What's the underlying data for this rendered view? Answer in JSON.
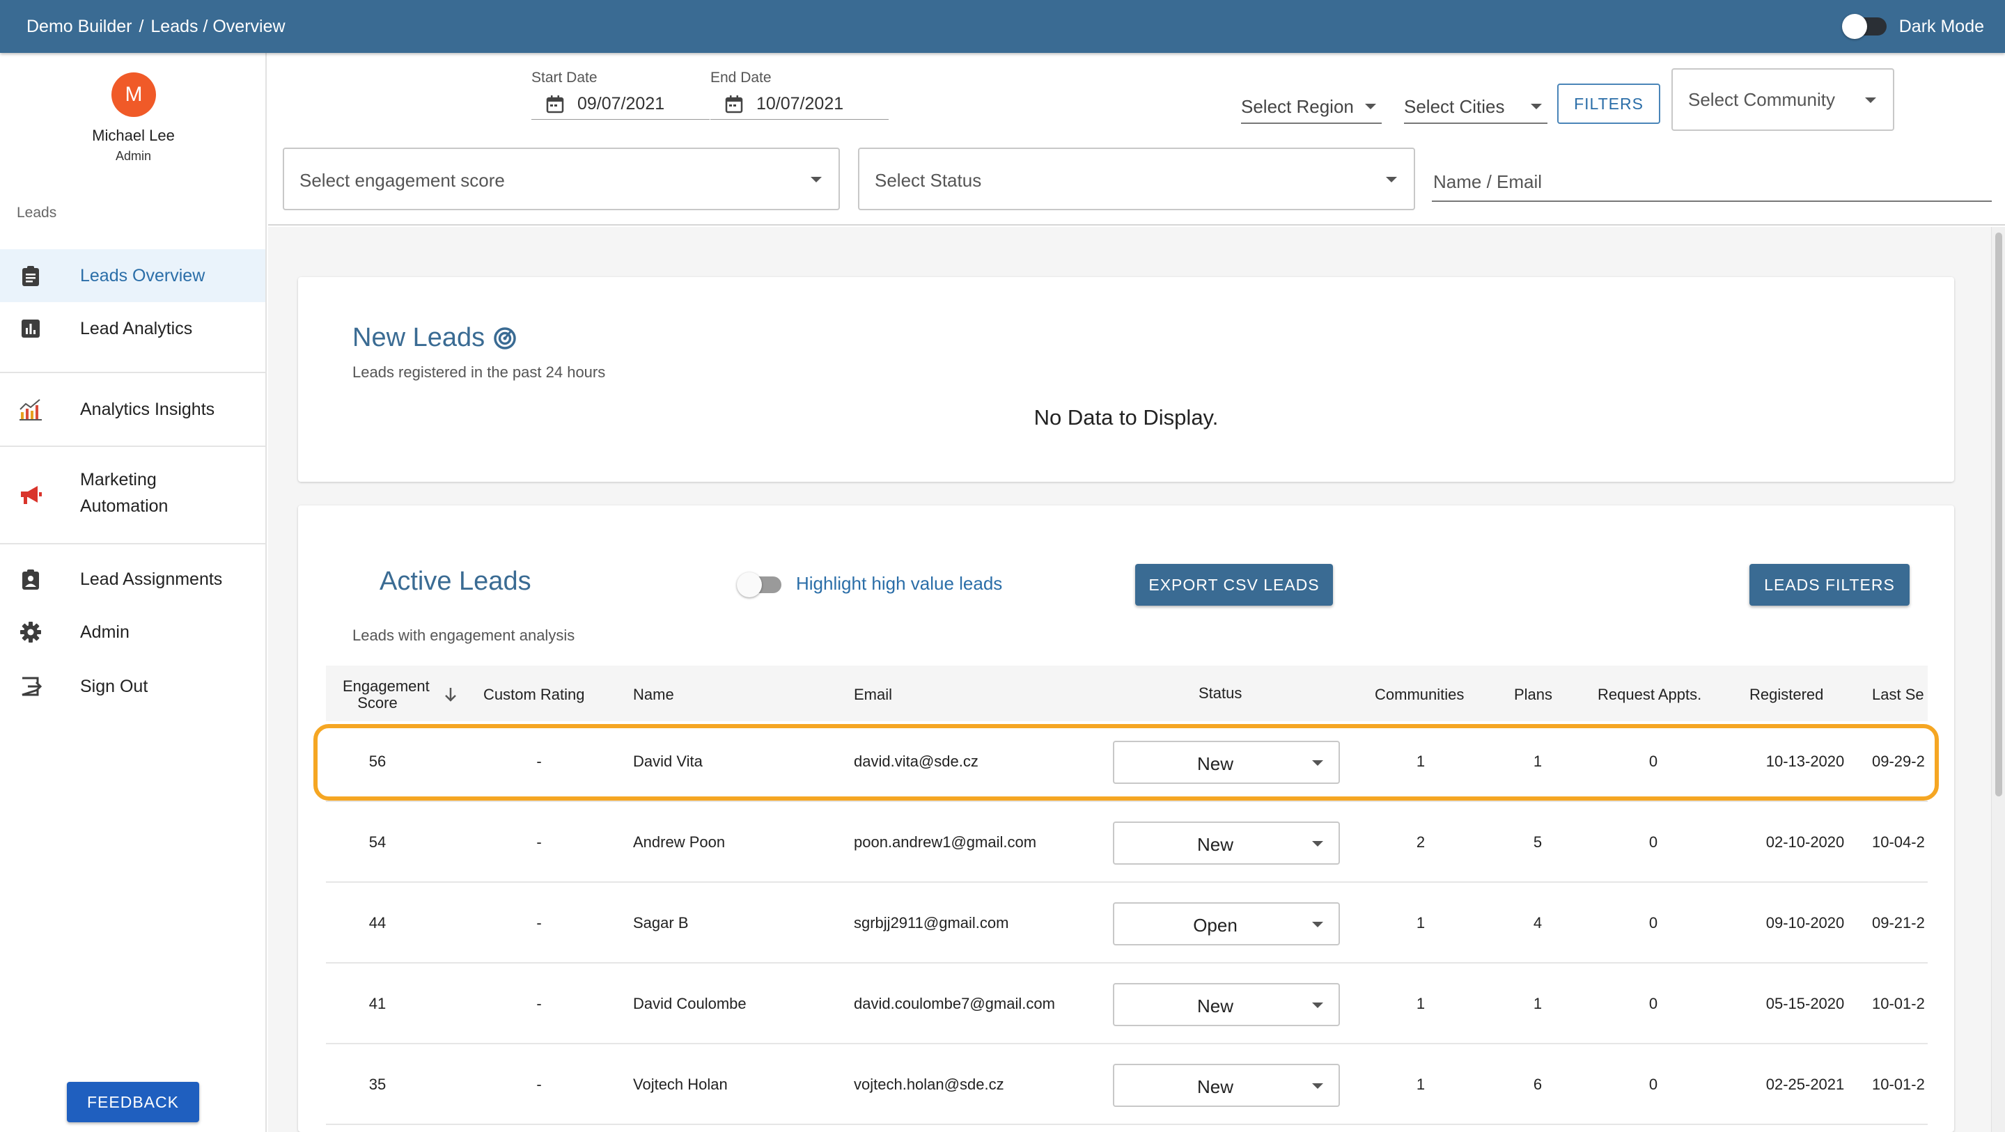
{
  "header": {
    "breadcrumb": [
      "Demo Builder",
      "/",
      "Leads / Overview"
    ],
    "dark_mode_label": "Dark Mode"
  },
  "user": {
    "initial": "M",
    "name": "Michael Lee",
    "role": "Admin"
  },
  "sidebar": {
    "section_label": "Leads",
    "items": [
      {
        "label": "Leads Overview",
        "icon": "clipboard-icon"
      },
      {
        "label": "Lead Analytics",
        "icon": "bar-chart-icon"
      },
      {
        "label": "Analytics Insights",
        "icon": "insights-chart-icon"
      },
      {
        "label": "Marketing",
        "label2": "Automation",
        "icon": "megaphone-icon"
      },
      {
        "label": "Lead Assignments",
        "icon": "assignment-icon"
      },
      {
        "label": "Admin",
        "icon": "gear-icon"
      },
      {
        "label": "Sign Out",
        "icon": "sign-out-icon"
      }
    ],
    "feedback_label": "FEEDBACK"
  },
  "filters": {
    "start_date_label": "Start Date",
    "start_date": "09/07/2021",
    "end_date_label": "End Date",
    "end_date": "10/07/2021",
    "region_placeholder": "Select Region",
    "cities_placeholder": "Select Cities",
    "filters_button": "FILTERS",
    "community_placeholder": "Select Community",
    "engagement_placeholder": "Select engagement score",
    "status_placeholder": "Select Status",
    "name_email_placeholder": "Name / Email"
  },
  "new_leads": {
    "title": "New Leads",
    "subtitle": "Leads registered in the past 24 hours",
    "empty_message": "No Data to Display."
  },
  "active_leads": {
    "title": "Active Leads",
    "highlight_label": "Highlight high value leads",
    "export_button": "EXPORT CSV LEADS",
    "filters_button": "LEADS FILTERS",
    "subtitle": "Leads with engagement analysis",
    "columns": {
      "score_line1": "Engagement",
      "score_line2": "Score",
      "rating": "Custom Rating",
      "name": "Name",
      "email": "Email",
      "status": "Status",
      "communities": "Communities",
      "plans": "Plans",
      "appts": "Request Appts.",
      "registered": "Registered",
      "last_seen": "Last Se"
    },
    "rows": [
      {
        "score": "56",
        "rating": "-",
        "name": "David Vita",
        "email": "david.vita@sde.cz",
        "status": "New",
        "communities": "1",
        "plans": "1",
        "appts": "0",
        "registered": "10-13-2020",
        "last_seen": "09-29-2"
      },
      {
        "score": "54",
        "rating": "-",
        "name": "Andrew Poon",
        "email": "poon.andrew1@gmail.com",
        "status": "New",
        "communities": "2",
        "plans": "5",
        "appts": "0",
        "registered": "02-10-2020",
        "last_seen": "10-04-2"
      },
      {
        "score": "44",
        "rating": "-",
        "name": "Sagar B",
        "email": "sgrbjj2911@gmail.com",
        "status": "Open",
        "communities": "1",
        "plans": "4",
        "appts": "0",
        "registered": "09-10-2020",
        "last_seen": "09-21-2"
      },
      {
        "score": "41",
        "rating": "-",
        "name": "David Coulombe",
        "email": "david.coulombe7@gmail.com",
        "status": "New",
        "communities": "1",
        "plans": "1",
        "appts": "0",
        "registered": "05-15-2020",
        "last_seen": "10-01-2"
      },
      {
        "score": "35",
        "rating": "-",
        "name": "Vojtech Holan",
        "email": "vojtech.holan@sde.cz",
        "status": "New",
        "communities": "1",
        "plans": "6",
        "appts": "0",
        "registered": "02-25-2021",
        "last_seen": "10-01-2"
      }
    ]
  },
  "colors": {
    "appbar": "#3a6b93",
    "accent": "#2b6ea8",
    "avatar": "#f05a28",
    "highlight": "#f5a623",
    "feedback": "#1f5fbf"
  }
}
